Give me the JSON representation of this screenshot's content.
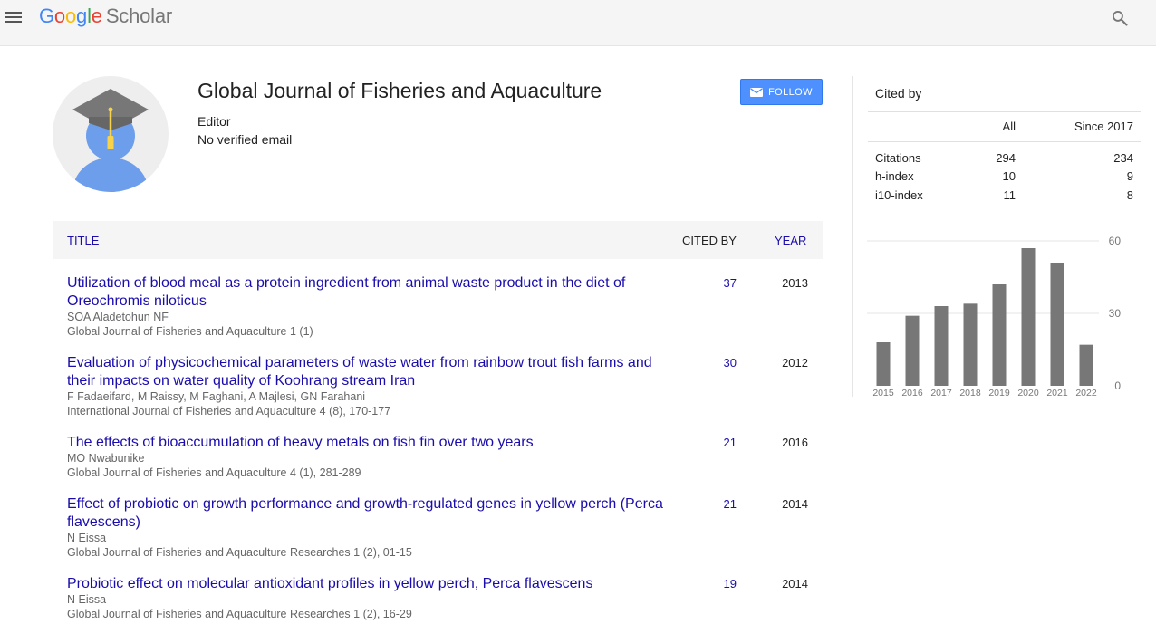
{
  "header": {
    "logo_letters": [
      "G",
      "o",
      "o",
      "g",
      "l",
      "e"
    ],
    "logo_product": "Scholar",
    "icons": {
      "menu": "hamburger-menu-icon",
      "search": "search-icon"
    }
  },
  "profile": {
    "name": "Global Journal of Fisheries and Aquaculture",
    "affiliation": "Editor",
    "email": "No verified email",
    "follow_label": "FOLLOW",
    "follow_icon": "envelope-icon"
  },
  "table": {
    "headers": {
      "title": "TITLE",
      "cited_by": "CITED BY",
      "year": "YEAR"
    },
    "rows": [
      {
        "title": "Utilization of blood meal as a protein ingredient from animal waste product in the diet of Oreochromis niloticus",
        "authors": "SOA Aladetohun NF",
        "venue": "Global Journal of Fisheries and Aquaculture 1 (1)",
        "cited_by": "37",
        "year": "2013"
      },
      {
        "title": "Evaluation of physicochemical parameters of waste water from rainbow trout fish farms and their impacts on water quality of Koohrang stream Iran",
        "authors": "F Fadaeifard, M Raissy, M Faghani, A Majlesi, GN Farahani",
        "venue": "International Journal of Fisheries and Aquaculture 4 (8), 170-177",
        "cited_by": "30",
        "year": "2012"
      },
      {
        "title": "The effects of bioaccumulation of heavy metals on fish fin over two years",
        "authors": "MO Nwabunike",
        "venue": "Global Journal of Fisheries and Aquaculture 4 (1), 281-289",
        "cited_by": "21",
        "year": "2016"
      },
      {
        "title": "Effect of probiotic on growth performance and growth-regulated genes in yellow perch (Perca flavescens)",
        "authors": "N Eissa",
        "venue": "Global Journal of Fisheries and Aquaculture Researches 1 (2), 01-15",
        "cited_by": "21",
        "year": "2014"
      },
      {
        "title": "Probiotic effect on molecular antioxidant profiles in yellow perch, Perca flavescens",
        "authors": "N Eissa",
        "venue": "Global Journal of Fisheries and Aquaculture Researches 1 (2), 16-29",
        "cited_by": "19",
        "year": "2014"
      }
    ]
  },
  "cited_by": {
    "title": "Cited by",
    "col_all": "All",
    "col_since": "Since 2017",
    "metrics": [
      {
        "label": "Citations",
        "all": "294",
        "since": "234"
      },
      {
        "label": "h-index",
        "all": "10",
        "since": "9"
      },
      {
        "label": "i10-index",
        "all": "11",
        "since": "8"
      }
    ]
  },
  "chart_data": {
    "type": "bar",
    "categories": [
      "2015",
      "2016",
      "2017",
      "2018",
      "2019",
      "2020",
      "2021",
      "2022"
    ],
    "values": [
      18,
      29,
      33,
      34,
      42,
      57,
      51,
      17
    ],
    "ylim": [
      0,
      60
    ],
    "yticks": [
      "0",
      "30",
      "60"
    ],
    "grid": true,
    "bar_color": "#777777"
  }
}
